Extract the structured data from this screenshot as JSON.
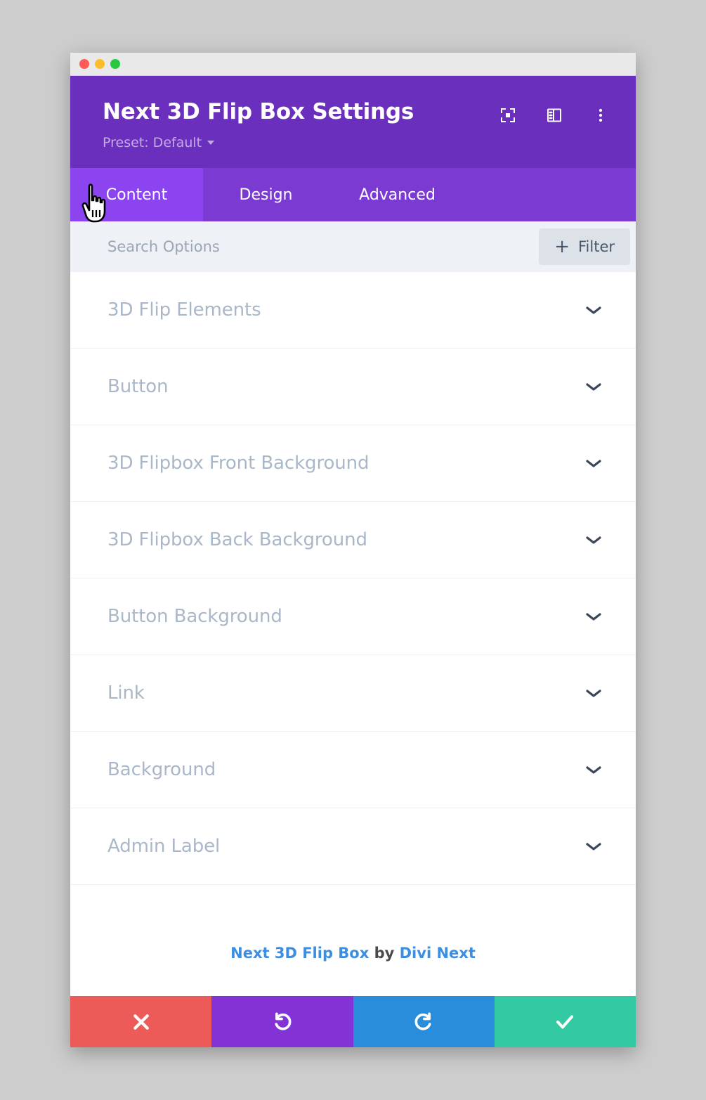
{
  "window": {
    "traffic_lights": [
      {
        "name": "close",
        "color": "#fc5c55"
      },
      {
        "name": "minimize",
        "color": "#fdbc2c"
      },
      {
        "name": "zoom",
        "color": "#28c940"
      }
    ]
  },
  "header": {
    "title": "Next 3D Flip Box Settings",
    "preset_label": "Preset: Default",
    "background_color": "#6a30bd",
    "actions": [
      {
        "icon": "focus-frame-icon"
      },
      {
        "icon": "layout-panel-icon"
      },
      {
        "icon": "more-vertical-icon"
      }
    ]
  },
  "tabs": {
    "active": "Content",
    "active_color": "#8b44ef",
    "inactive_color": "#7b3ad2",
    "items": [
      {
        "label": "Content",
        "active": true
      },
      {
        "label": "Design",
        "active": false
      },
      {
        "label": "Advanced",
        "active": false
      }
    ]
  },
  "search": {
    "placeholder": "Search Options",
    "value": "",
    "filter_label": "Filter",
    "filter_plus": "+"
  },
  "options": {
    "rows": [
      {
        "label": "3D Flip Elements"
      },
      {
        "label": "Button"
      },
      {
        "label": "3D Flipbox Front Background"
      },
      {
        "label": "3D Flipbox Back Background"
      },
      {
        "label": "Button Background"
      },
      {
        "label": "Link"
      },
      {
        "label": "Background"
      },
      {
        "label": "Admin Label"
      }
    ],
    "label_color": "#aab7c8"
  },
  "credit": {
    "module_name": "Next 3D Flip Box",
    "by": " by ",
    "vendor": "Divi Next",
    "link_color": "#3b8ee0"
  },
  "action_bar": {
    "buttons": [
      {
        "name": "cancel",
        "icon": "close-x-icon",
        "color": "#ec5b57"
      },
      {
        "name": "undo",
        "icon": "undo-icon",
        "color": "#8332d6"
      },
      {
        "name": "redo",
        "icon": "redo-icon",
        "color": "#2a8ddb"
      },
      {
        "name": "save",
        "icon": "checkmark-icon",
        "color": "#33c9a2"
      }
    ]
  }
}
